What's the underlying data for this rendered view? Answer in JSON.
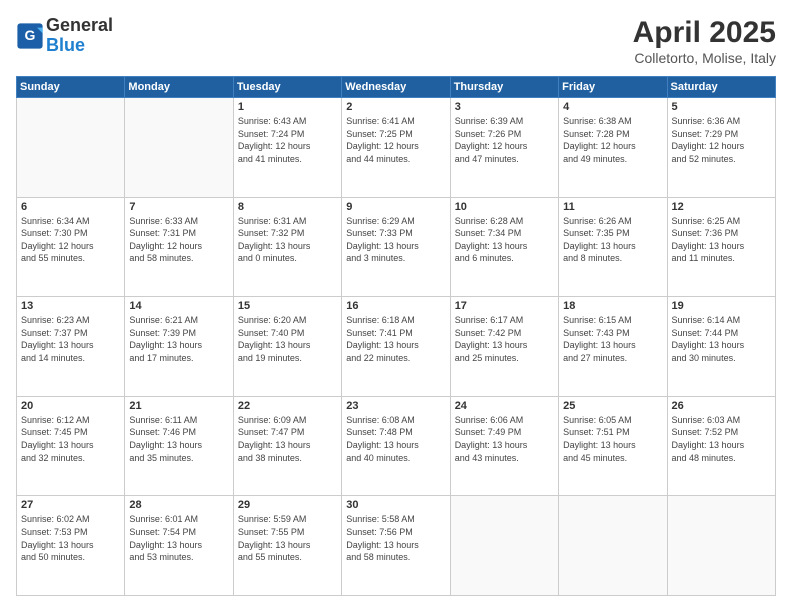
{
  "header": {
    "logo_line1": "General",
    "logo_line2": "Blue",
    "month_title": "April 2025",
    "subtitle": "Colletorto, Molise, Italy"
  },
  "weekdays": [
    "Sunday",
    "Monday",
    "Tuesday",
    "Wednesday",
    "Thursday",
    "Friday",
    "Saturday"
  ],
  "weeks": [
    [
      {
        "day": "",
        "info": ""
      },
      {
        "day": "",
        "info": ""
      },
      {
        "day": "1",
        "info": "Sunrise: 6:43 AM\nSunset: 7:24 PM\nDaylight: 12 hours\nand 41 minutes."
      },
      {
        "day": "2",
        "info": "Sunrise: 6:41 AM\nSunset: 7:25 PM\nDaylight: 12 hours\nand 44 minutes."
      },
      {
        "day": "3",
        "info": "Sunrise: 6:39 AM\nSunset: 7:26 PM\nDaylight: 12 hours\nand 47 minutes."
      },
      {
        "day": "4",
        "info": "Sunrise: 6:38 AM\nSunset: 7:28 PM\nDaylight: 12 hours\nand 49 minutes."
      },
      {
        "day": "5",
        "info": "Sunrise: 6:36 AM\nSunset: 7:29 PM\nDaylight: 12 hours\nand 52 minutes."
      }
    ],
    [
      {
        "day": "6",
        "info": "Sunrise: 6:34 AM\nSunset: 7:30 PM\nDaylight: 12 hours\nand 55 minutes."
      },
      {
        "day": "7",
        "info": "Sunrise: 6:33 AM\nSunset: 7:31 PM\nDaylight: 12 hours\nand 58 minutes."
      },
      {
        "day": "8",
        "info": "Sunrise: 6:31 AM\nSunset: 7:32 PM\nDaylight: 13 hours\nand 0 minutes."
      },
      {
        "day": "9",
        "info": "Sunrise: 6:29 AM\nSunset: 7:33 PM\nDaylight: 13 hours\nand 3 minutes."
      },
      {
        "day": "10",
        "info": "Sunrise: 6:28 AM\nSunset: 7:34 PM\nDaylight: 13 hours\nand 6 minutes."
      },
      {
        "day": "11",
        "info": "Sunrise: 6:26 AM\nSunset: 7:35 PM\nDaylight: 13 hours\nand 8 minutes."
      },
      {
        "day": "12",
        "info": "Sunrise: 6:25 AM\nSunset: 7:36 PM\nDaylight: 13 hours\nand 11 minutes."
      }
    ],
    [
      {
        "day": "13",
        "info": "Sunrise: 6:23 AM\nSunset: 7:37 PM\nDaylight: 13 hours\nand 14 minutes."
      },
      {
        "day": "14",
        "info": "Sunrise: 6:21 AM\nSunset: 7:39 PM\nDaylight: 13 hours\nand 17 minutes."
      },
      {
        "day": "15",
        "info": "Sunrise: 6:20 AM\nSunset: 7:40 PM\nDaylight: 13 hours\nand 19 minutes."
      },
      {
        "day": "16",
        "info": "Sunrise: 6:18 AM\nSunset: 7:41 PM\nDaylight: 13 hours\nand 22 minutes."
      },
      {
        "day": "17",
        "info": "Sunrise: 6:17 AM\nSunset: 7:42 PM\nDaylight: 13 hours\nand 25 minutes."
      },
      {
        "day": "18",
        "info": "Sunrise: 6:15 AM\nSunset: 7:43 PM\nDaylight: 13 hours\nand 27 minutes."
      },
      {
        "day": "19",
        "info": "Sunrise: 6:14 AM\nSunset: 7:44 PM\nDaylight: 13 hours\nand 30 minutes."
      }
    ],
    [
      {
        "day": "20",
        "info": "Sunrise: 6:12 AM\nSunset: 7:45 PM\nDaylight: 13 hours\nand 32 minutes."
      },
      {
        "day": "21",
        "info": "Sunrise: 6:11 AM\nSunset: 7:46 PM\nDaylight: 13 hours\nand 35 minutes."
      },
      {
        "day": "22",
        "info": "Sunrise: 6:09 AM\nSunset: 7:47 PM\nDaylight: 13 hours\nand 38 minutes."
      },
      {
        "day": "23",
        "info": "Sunrise: 6:08 AM\nSunset: 7:48 PM\nDaylight: 13 hours\nand 40 minutes."
      },
      {
        "day": "24",
        "info": "Sunrise: 6:06 AM\nSunset: 7:49 PM\nDaylight: 13 hours\nand 43 minutes."
      },
      {
        "day": "25",
        "info": "Sunrise: 6:05 AM\nSunset: 7:51 PM\nDaylight: 13 hours\nand 45 minutes."
      },
      {
        "day": "26",
        "info": "Sunrise: 6:03 AM\nSunset: 7:52 PM\nDaylight: 13 hours\nand 48 minutes."
      }
    ],
    [
      {
        "day": "27",
        "info": "Sunrise: 6:02 AM\nSunset: 7:53 PM\nDaylight: 13 hours\nand 50 minutes."
      },
      {
        "day": "28",
        "info": "Sunrise: 6:01 AM\nSunset: 7:54 PM\nDaylight: 13 hours\nand 53 minutes."
      },
      {
        "day": "29",
        "info": "Sunrise: 5:59 AM\nSunset: 7:55 PM\nDaylight: 13 hours\nand 55 minutes."
      },
      {
        "day": "30",
        "info": "Sunrise: 5:58 AM\nSunset: 7:56 PM\nDaylight: 13 hours\nand 58 minutes."
      },
      {
        "day": "",
        "info": ""
      },
      {
        "day": "",
        "info": ""
      },
      {
        "day": "",
        "info": ""
      }
    ]
  ]
}
